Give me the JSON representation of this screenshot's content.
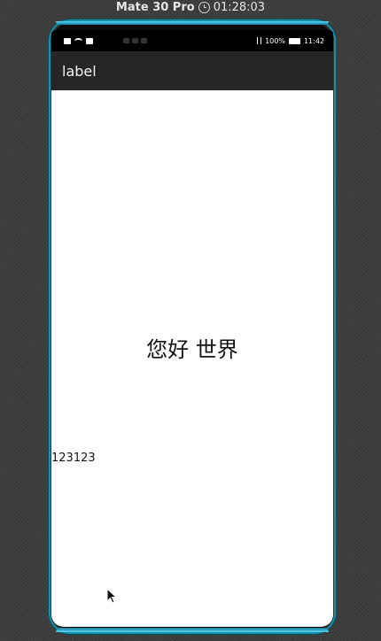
{
  "device": {
    "name": "Mate 30 Pro",
    "time": "01:28:03"
  },
  "status_bar": {
    "battery": "100%",
    "clock": "11:42"
  },
  "action_bar": {
    "title": "label"
  },
  "content": {
    "center_text": "您好 世界",
    "bottom_text": "123123"
  },
  "colors": {
    "action_bar_bg": "#262626",
    "screen_bg": "#ffffff",
    "frame_accent": "#1a8fa8"
  }
}
